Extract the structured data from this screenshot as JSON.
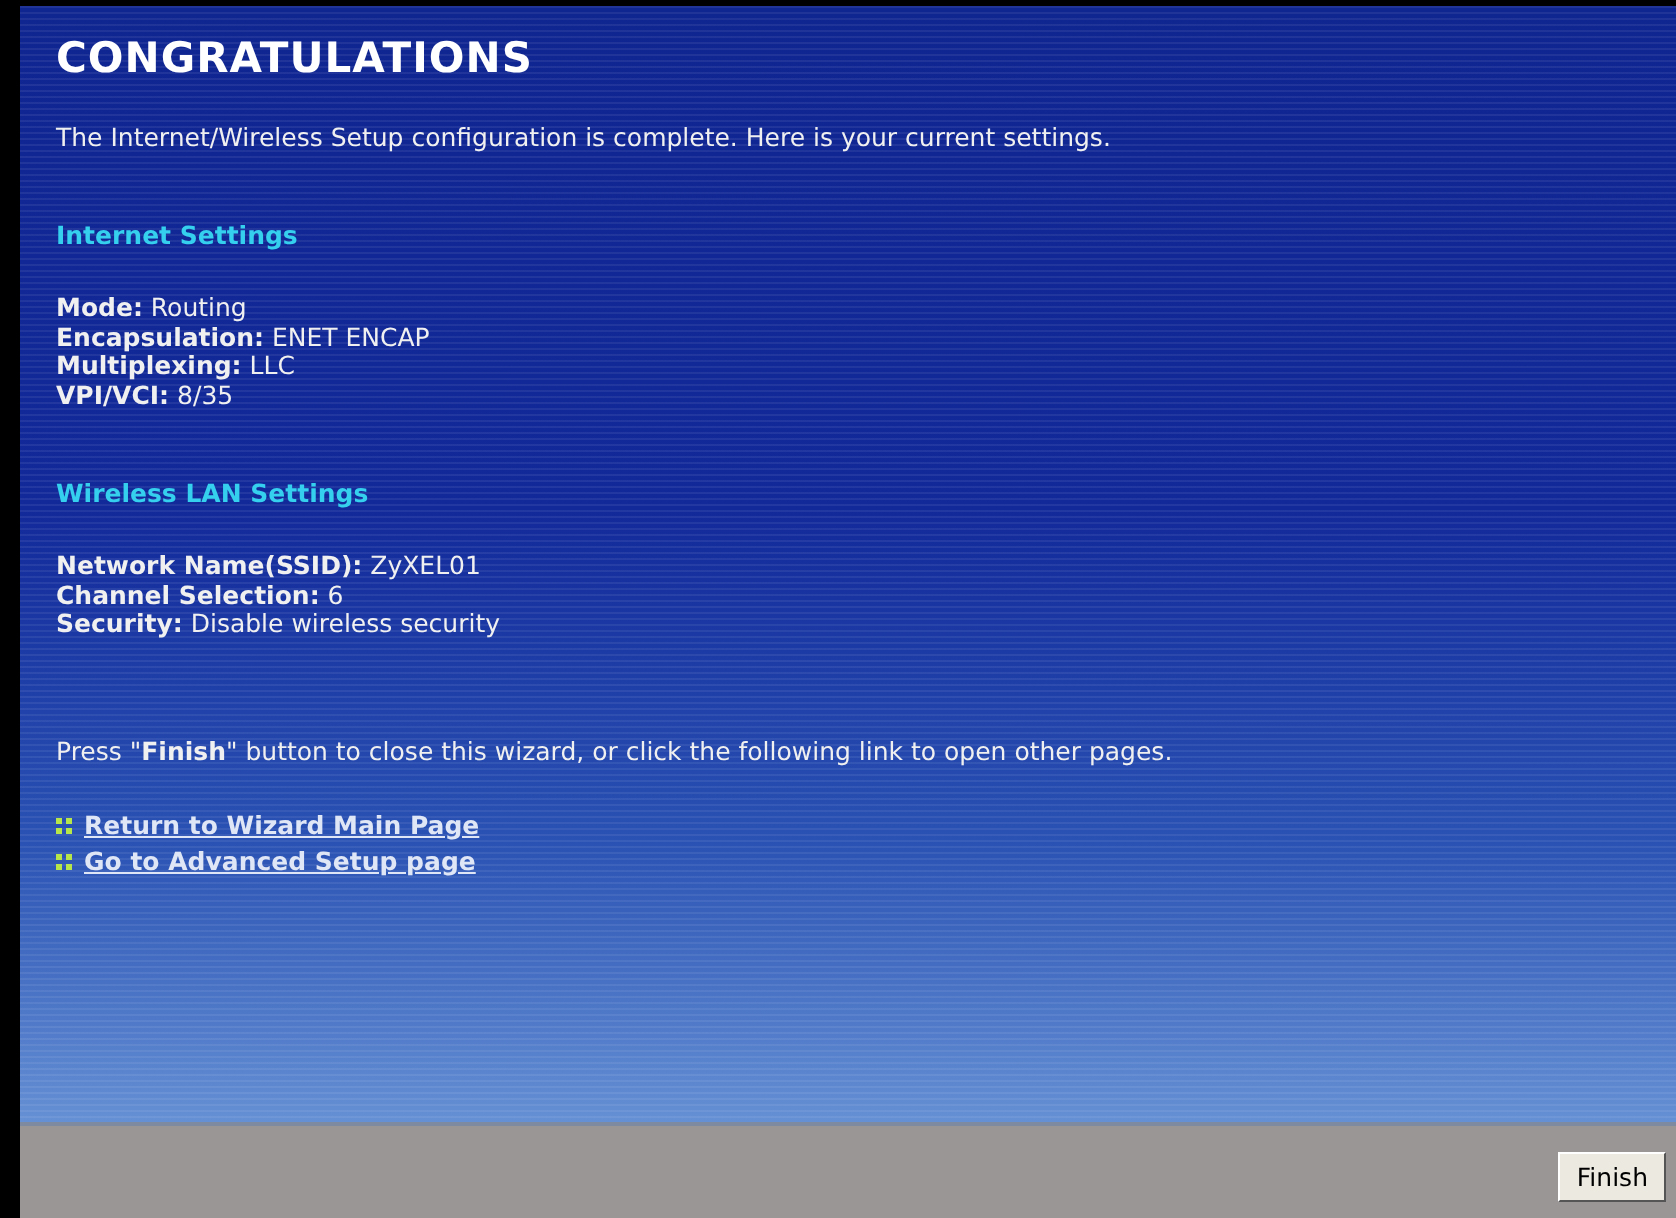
{
  "title": "CONGRATULATIONS",
  "intro": "The Internet/Wireless Setup configuration is complete. Here is your current settings.",
  "sections": [
    {
      "heading": "Internet Settings",
      "lines": [
        "**Mode:** Routing",
        "**Encapsulation:** ENET ENCAP",
        "**Multiplexing:** LLC",
        "**VPI/VCI:** 8/35"
      ]
    },
    {
      "heading": "Wireless LAN Settings",
      "lines": [
        "**Network Name(SSID):** ZyXEL01",
        "**Channel Selection:** 6",
        "**Security:** Disable wireless security"
      ]
    }
  ],
  "note": "Press \"**Finish**\" button to close this wizard, or click the following link to open other pages.",
  "links": [
    "Return to Wizard Main Page",
    "Go to Advanced Setup page"
  ],
  "button": "Finish"
}
